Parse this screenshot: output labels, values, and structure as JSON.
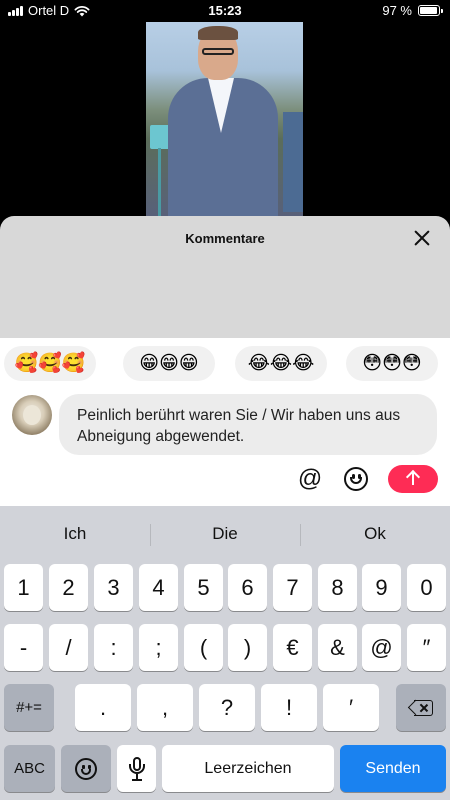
{
  "status_bar": {
    "carrier": "Ortel D",
    "time": "15:23",
    "battery": "97 %",
    "battery_level": 0.97
  },
  "video": {
    "icon": "video-thumbnail"
  },
  "comments_sheet": {
    "title": "Kommentare",
    "close_icon": "close-icon"
  },
  "quick_emojis": [
    {
      "emoji": "🥰🥰🥰"
    },
    {
      "emoji": "😁😁😁"
    },
    {
      "emoji": "😂😂😂"
    },
    {
      "emoji": "😳😳😳"
    }
  ],
  "composer": {
    "text": "Peinlich berührt waren Sie / Wir haben uns aus Abneigung abgewendet.",
    "mention": "@",
    "emoji_icon": "smile-icon",
    "send_icon": "arrow-up-icon",
    "accent": "#fe2c55"
  },
  "keyboard": {
    "suggestions": [
      "Ich",
      "Die",
      "Ok"
    ],
    "row1": [
      "1",
      "2",
      "3",
      "4",
      "5",
      "6",
      "7",
      "8",
      "9",
      "0"
    ],
    "row2": [
      "-",
      "/",
      ":",
      ";",
      "(",
      ")",
      "€",
      "&",
      "@",
      "″"
    ],
    "row3_switch": "#+=",
    "row3": [
      ".",
      ",",
      "?",
      "!",
      "′"
    ],
    "backspace_icon": "backspace-icon",
    "abc": "ABC",
    "emoji_key_icon": "emoji-icon",
    "mic_icon": "microphone-icon",
    "space": "Leerzeichen",
    "send": "Senden",
    "send_color": "#1a82f0"
  }
}
